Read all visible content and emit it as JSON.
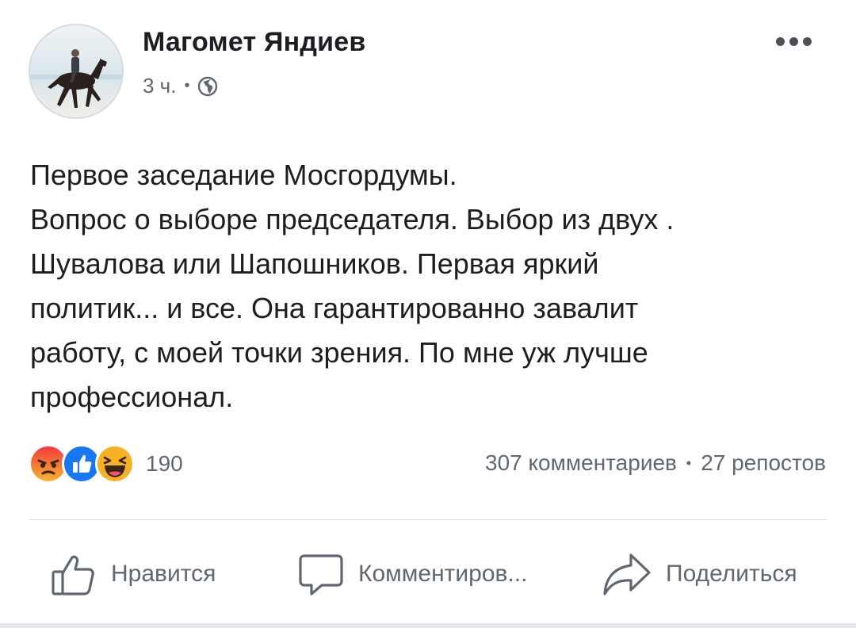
{
  "post": {
    "author": "Магомет Яндиев",
    "time": "3 ч.",
    "separator": "•",
    "privacy_icon": "globe-icon",
    "text_lines": [
      "Первое заседание Мосгордумы.",
      "Вопрос о выборе председателя. Выбор из двух .",
      "Шувалова или Шапошников. Первая яркий",
      "политик... и все. Она гарантированно завалит",
      "работу, с моей точки зрения. По мне уж лучше",
      "профессионал."
    ]
  },
  "reactions": {
    "icons": [
      "angry-icon",
      "like-icon",
      "haha-icon"
    ],
    "count": "190"
  },
  "stats": {
    "comments": "307 комментариев",
    "separator": "•",
    "shares": "27 репостов"
  },
  "actions": {
    "like": "Нравится",
    "comment": "Комментиров...",
    "share": "Поделиться"
  },
  "colors": {
    "text": "#1c1e21",
    "secondary": "#606770",
    "like_blue": "#1877f2",
    "angry": "#f0663f",
    "haha": "#f7b125"
  }
}
